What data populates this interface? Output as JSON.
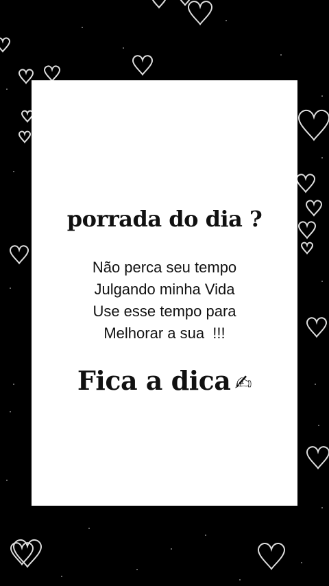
{
  "colors": {
    "background": "#000000",
    "card": "#ffffff",
    "text": "#111111",
    "hearts": "#dddddd"
  },
  "card": {
    "headline": "porrada do dia ?",
    "message_lines": [
      "Não perca seu tempo",
      "Julgando minha Vida",
      "Use esse tempo para",
      "Melhorar a sua  !!!"
    ],
    "signoff": "Fica a dica",
    "signoff_icon": "writing-hand-icon",
    "signoff_glyph": "✍"
  },
  "background": {
    "pattern": "heart-outline-icon"
  }
}
